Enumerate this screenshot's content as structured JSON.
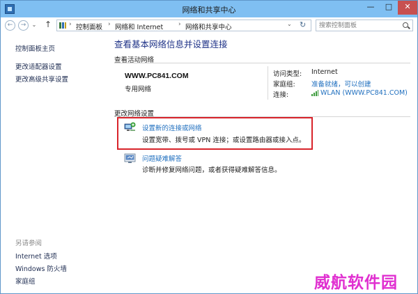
{
  "window": {
    "title": "网络和共享中心",
    "controls": {
      "minimize": "—",
      "maximize": "□",
      "close": "✕"
    }
  },
  "nav": {
    "back": "←",
    "forward": "→",
    "history": "⌄",
    "up": "↑",
    "breadcrumbs": [
      "控制面板",
      "网络和 Internet",
      "网络和共享中心"
    ],
    "separator": "›",
    "refresh": "↻",
    "search_placeholder": "搜索控制面板"
  },
  "sidebar": {
    "items": [
      "控制面板主页",
      "更改适配器设置",
      "更改高级共享设置"
    ],
    "see_also_label": "另请参阅",
    "see_also": [
      "Internet 选项",
      "Windows 防火墙",
      "家庭组"
    ]
  },
  "main": {
    "title": "查看基本网络信息并设置连接",
    "active_networks_label": "查看活动网络",
    "network": {
      "name": "WWW.PC841.COM",
      "profile": "专用网络",
      "access_type_label": "访问类型:",
      "access_type": "Internet",
      "homegroup_label": "家庭组:",
      "homegroup": "准备就绪，可以创建",
      "connections_label": "连接:",
      "connection": "WLAN (WWW.PC841.COM)"
    },
    "change_settings_label": "更改网络设置",
    "tasks": [
      {
        "title": "设置新的连接或网络",
        "desc": "设置宽带、拨号或 VPN 连接；或设置路由器或接入点。",
        "icon": "network-setup-icon"
      },
      {
        "title": "问题疑难解答",
        "desc": "诊断并修复网络问题，或者获得疑难解答信息。",
        "icon": "troubleshoot-icon"
      }
    ]
  },
  "colors": {
    "title_bar": "#7fbff2",
    "link": "#1f6fbf",
    "heading": "#1e3287",
    "highlight": "#d8232a",
    "watermark": "#e02fd0"
  },
  "watermark": "威航软件园"
}
